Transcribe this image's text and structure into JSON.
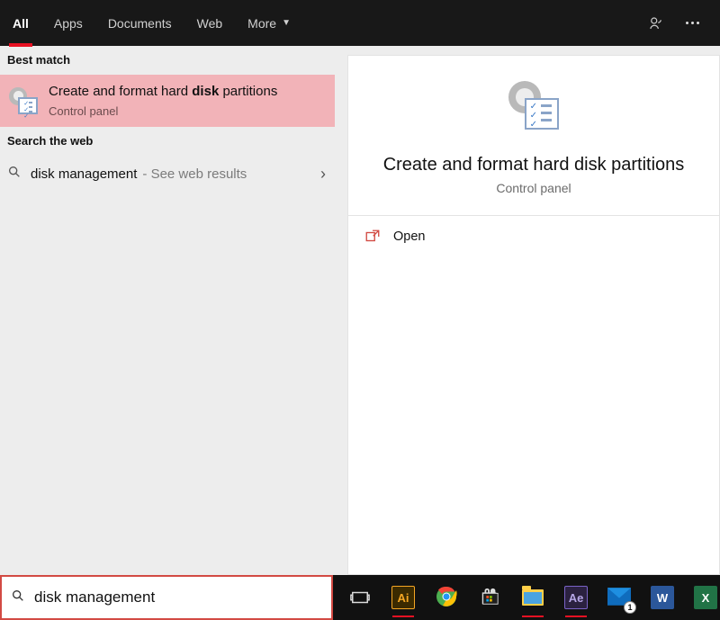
{
  "topbar": {
    "tabs": [
      {
        "label": "All",
        "active": true
      },
      {
        "label": "Apps",
        "active": false
      },
      {
        "label": "Documents",
        "active": false
      },
      {
        "label": "Web",
        "active": false
      },
      {
        "label": "More",
        "active": false,
        "has_dropdown": true
      }
    ]
  },
  "left": {
    "best_match_header": "Best match",
    "best_match": {
      "title_prefix": "Create and format hard ",
      "title_bold": "disk",
      "title_suffix": " partitions",
      "subtitle": "Control panel"
    },
    "search_web_header": "Search the web",
    "web_result": {
      "term": "disk management",
      "hint": "- See web results"
    }
  },
  "preview": {
    "title": "Create and format hard disk partitions",
    "subtitle": "Control panel",
    "actions": [
      {
        "label": "Open"
      }
    ]
  },
  "search": {
    "value": "disk management",
    "placeholder": "Type here to search"
  },
  "taskbar": {
    "mail_badge": "1",
    "items": [
      "task-view",
      "illustrator",
      "chrome",
      "store",
      "file-explorer",
      "after-effects",
      "mail",
      "word",
      "excel"
    ]
  }
}
